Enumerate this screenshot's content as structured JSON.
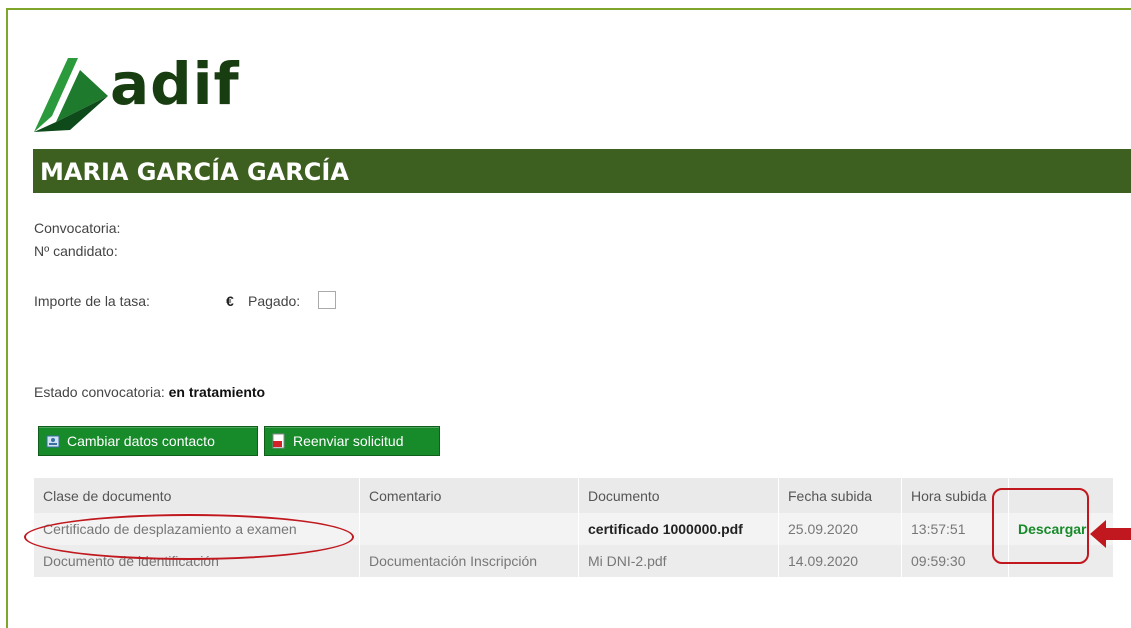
{
  "brand": {
    "logo_text": "adif",
    "color": "#173d10",
    "accent": "#7fa52a"
  },
  "candidate": {
    "name": "MARIA GARCÍA GARCÍA"
  },
  "fields": {
    "convocatoria_label": "Convocatoria:",
    "candidato_label": "Nº candidato:",
    "importe_label": "Importe de la tasa:",
    "currency": "€",
    "pagado_label": "Pagado:",
    "pagado_checked": false,
    "estado_label": "Estado convocatoria:",
    "estado_value": "en tratamiento"
  },
  "buttons": {
    "cambiar": "Cambiar datos contacto",
    "reenviar": "Reenviar solicitud"
  },
  "table": {
    "headers": [
      "Clase de documento",
      "Comentario",
      "Documento",
      "Fecha subida",
      "Hora subida",
      ""
    ],
    "rows": [
      [
        "Certificado de desplazamiento a examen",
        "",
        "certificado 1000000.pdf",
        "25.09.2020",
        "13:57:51",
        "Descargar"
      ],
      [
        "Documento de identificación",
        "Documentación Inscripción",
        "Mi DNI-2.pdf",
        "14.09.2020",
        "09:59:30",
        ""
      ]
    ]
  },
  "colors": {
    "name_bar": "#3d5f20",
    "button": "#178a2a",
    "highlight": "#c0181e"
  }
}
